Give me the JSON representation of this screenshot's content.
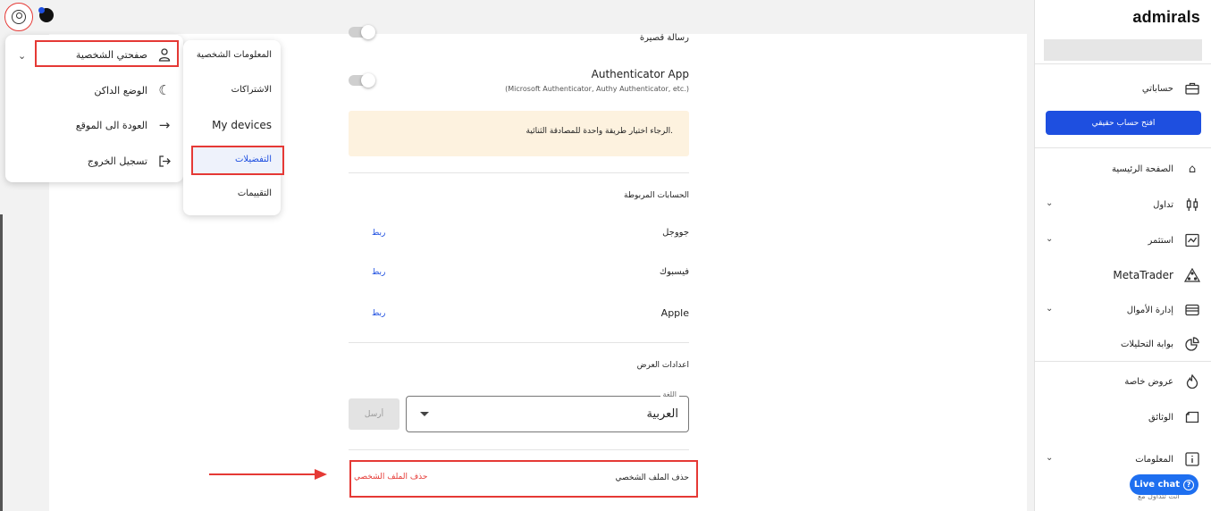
{
  "menu": {
    "items": [
      {
        "label": "صفحتي الشخصية",
        "icon": "person-icon"
      },
      {
        "label": "الوضع الداكن",
        "icon": "moon-icon"
      },
      {
        "label": "العودة الى الموقع",
        "icon": "arrow-right-icon"
      },
      {
        "label": "تسجيل الخروج",
        "icon": "logout-icon"
      }
    ]
  },
  "submenu": {
    "items": [
      "المعلومات الشخصية",
      "الاشتراكات",
      "My devices",
      "التفضيلات",
      "التقييمات"
    ],
    "active": "التفضيلات"
  },
  "content": {
    "sms_label": "رسالة قصيرة",
    "auth_app_title": "Authenticator App",
    "auth_app_sub": "(Microsoft Authenticator, Authy Authenticator, etc.)",
    "warning": "الرجاء اختيار طريقة واحدة للمصادقة الثنائية.",
    "linked_title": "الحسابات المربوطة",
    "linked": [
      {
        "name": "جووجل",
        "action": "ربط"
      },
      {
        "name": "فيسبوك",
        "action": "ربط"
      },
      {
        "name": "Apple",
        "action": "ربط"
      }
    ],
    "display_title": "اعدادات العرض",
    "language_label": "اللغة",
    "language_value": "العربية",
    "send_button": "أرسل",
    "delete_label": "حذف الملف الشخصي",
    "delete_link": "حذف الملف الشخصي"
  },
  "sidebar": {
    "logo": "admirals",
    "accounts_label": "حساباتي",
    "open_account_button": "افتح حساب حقيقي",
    "nav": [
      {
        "label": "الصفحة الرئيسية",
        "icon": "home-icon",
        "chevron": false
      },
      {
        "label": "تداول",
        "icon": "candles-icon",
        "chevron": true
      },
      {
        "label": "استثمر",
        "icon": "chart-icon",
        "chevron": true
      },
      {
        "label": "MetaTrader",
        "icon": "metatrader-icon",
        "chevron": false
      },
      {
        "label": "إدارة الأموال",
        "icon": "wallet-icon",
        "chevron": true
      },
      {
        "label": "بوابة التحليلات",
        "icon": "pie-icon",
        "chevron": false
      }
    ],
    "nav2": [
      {
        "label": "عروض خاصة",
        "icon": "flame-icon",
        "chevron": false
      },
      {
        "label": "الوثائق",
        "icon": "document-icon",
        "chevron": false
      },
      {
        "label": "المعلومات",
        "icon": "info-icon",
        "chevron": true
      }
    ],
    "behind_text": "أنت تتداول مع"
  },
  "live_chat": {
    "label": "Live chat"
  }
}
